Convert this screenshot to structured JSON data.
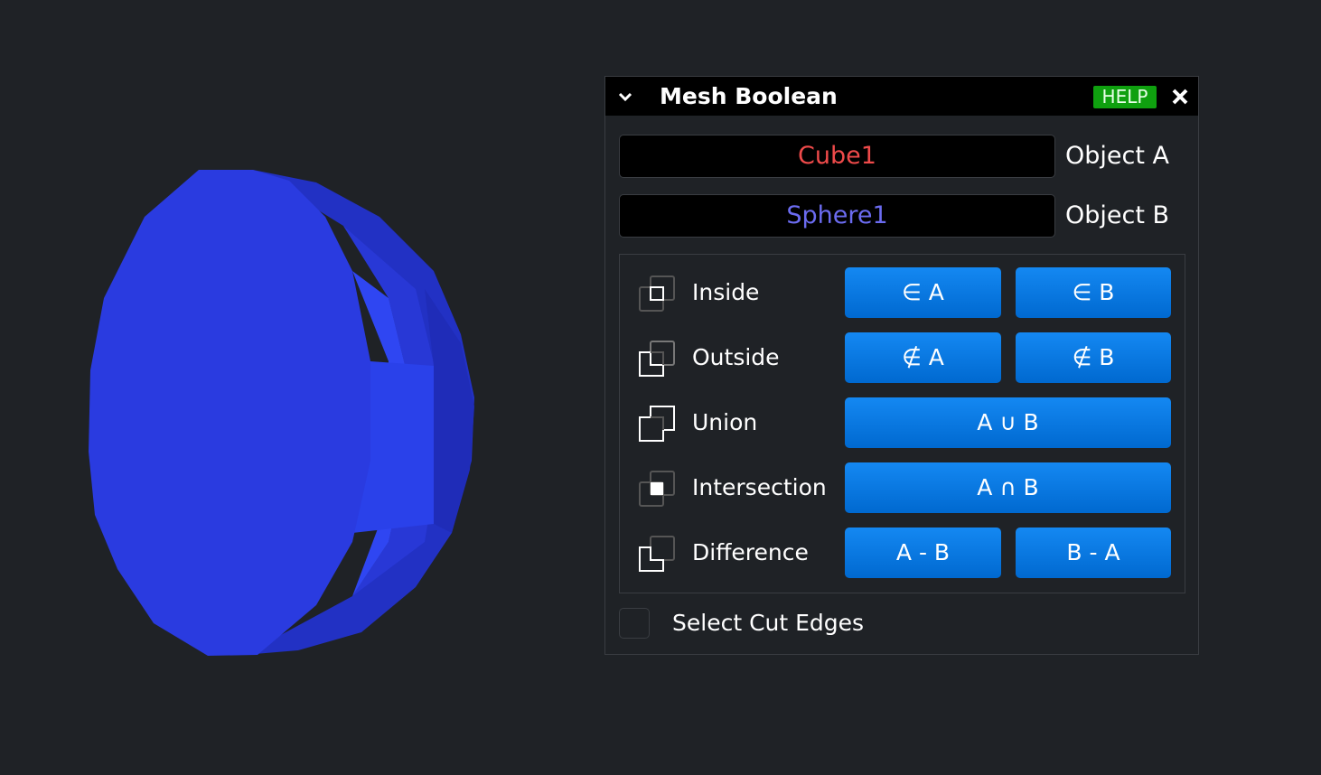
{
  "panel": {
    "title": "Mesh Boolean",
    "help_label": "HELP",
    "object_a": {
      "value": "Cube1",
      "label": "Object A",
      "color": "#ee4a4a"
    },
    "object_b": {
      "value": "Sphere1",
      "label": "Object B",
      "color": "#6b6bf0"
    },
    "operations": [
      {
        "label": "Inside",
        "icon": "inside-icon",
        "buttons": [
          "∈ A",
          "∈ B"
        ]
      },
      {
        "label": "Outside",
        "icon": "outside-icon",
        "buttons": [
          "∉ A",
          "∉ B"
        ]
      },
      {
        "label": "Union",
        "icon": "union-icon",
        "buttons": [
          "A ∪ B"
        ]
      },
      {
        "label": "Intersection",
        "icon": "intersection-icon",
        "buttons": [
          "A ∩ B"
        ]
      },
      {
        "label": "Difference",
        "icon": "difference-icon",
        "buttons": [
          "A - B",
          "B - A"
        ]
      }
    ],
    "select_cut_edges": {
      "label": "Select Cut Edges",
      "checked": false
    }
  },
  "colors": {
    "background": "#1f2226",
    "mesh": "#2a3be0",
    "button": "#0a7ae6",
    "help": "#0fa00f"
  }
}
